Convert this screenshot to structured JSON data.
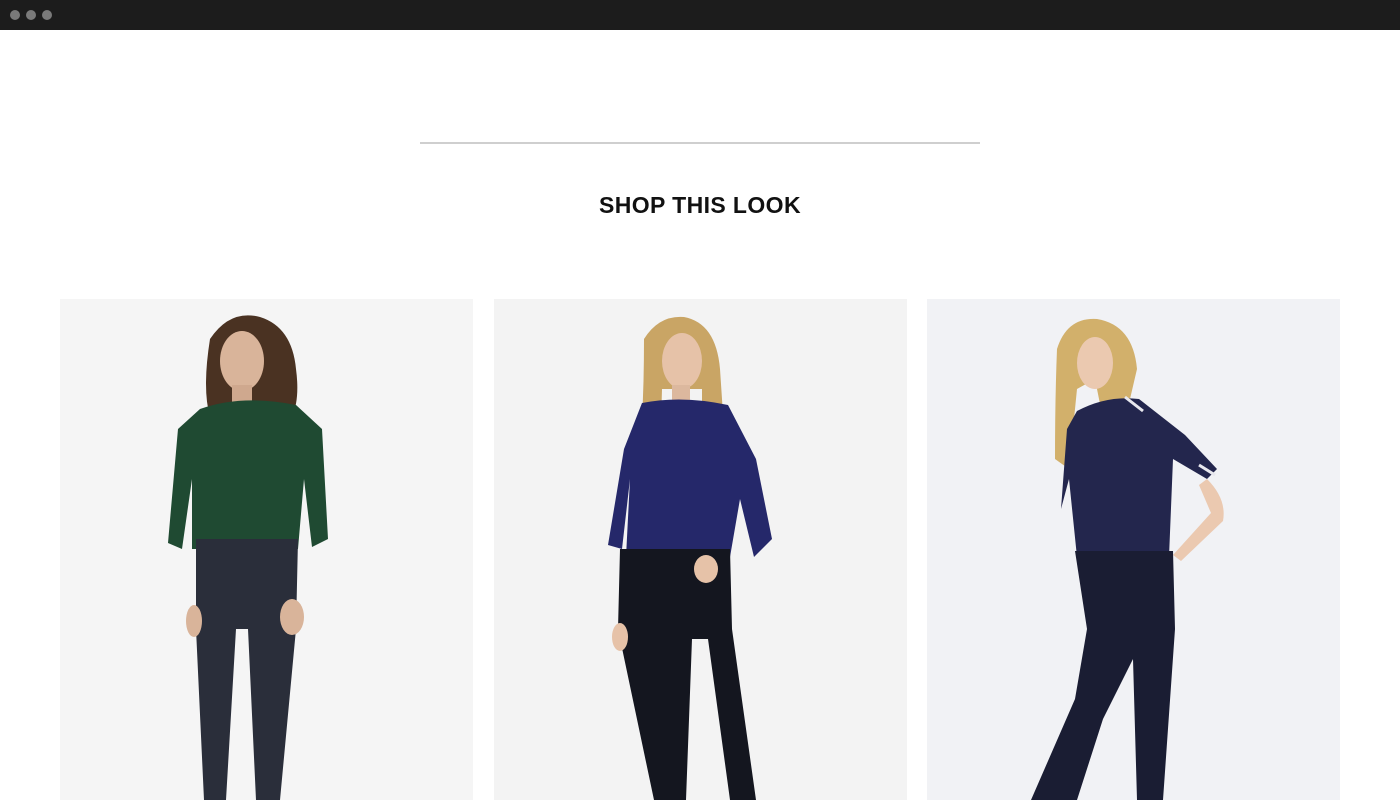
{
  "section": {
    "title": "SHOP THIS LOOK"
  },
  "products": [
    {
      "name": "product-1",
      "top_color": "#1f4a32",
      "jeans_color": "#2a2e3a",
      "hair_color": "#4a3222",
      "icon": "model-green-shirt"
    },
    {
      "name": "product-2",
      "top_color": "#25286a",
      "jeans_color": "#14161f",
      "hair_color": "#c9a565",
      "icon": "model-navy-shirt"
    },
    {
      "name": "product-3",
      "top_color": "#23264d",
      "jeans_color": "#1a1d33",
      "hair_color": "#d2b06b",
      "icon": "model-navy-polo"
    }
  ],
  "colors": {
    "background": "#ffffff",
    "titlebar": "#1c1c1c",
    "divider": "#cfcfcf",
    "photo_bg": "#f4f4f4"
  }
}
